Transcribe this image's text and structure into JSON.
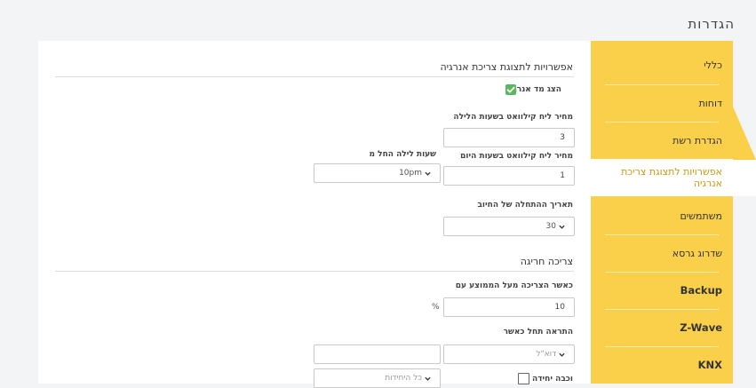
{
  "page": {
    "title": "הגדרות"
  },
  "sidebar": {
    "items": [
      {
        "label": "כללי"
      },
      {
        "label": "דוחות"
      },
      {
        "label": "הגדרת רשת"
      },
      {
        "label": "אפשרויות לתצוגת צריכת אנרגיה",
        "active": true
      },
      {
        "label": "משתמשים"
      },
      {
        "label": "שדרוג גרסא"
      },
      {
        "label": "Backup"
      },
      {
        "label": "Z-Wave"
      },
      {
        "label": "KNX"
      }
    ]
  },
  "energy": {
    "section_title": "אפשרויות לתצוגת צריכת אנרגיה",
    "show_meter_label": "הצג מד אנרגיה",
    "show_meter_checked": true,
    "night_price_label": "מחיר ליח קילוואט בשעות הלילה",
    "night_price_value": "3",
    "day_price_label": "מחיר ליח קילוואט בשעות היום",
    "day_price_value": "1",
    "night_start_label": "שעות לילה החל מ",
    "night_start_value": "10pm",
    "billing_start_label": "תאריך ההתחלה של החיוב",
    "billing_start_value": "30"
  },
  "anomaly": {
    "section_title": "צריכה חריגה",
    "threshold_label": "כאשר הצריכה מעל הממוצע עם",
    "threshold_value": "10",
    "threshold_unit": "%",
    "alert_label": "התראה תחל כאשר",
    "alert_select_placeholder": "דוא\"ל",
    "unit_off_label": "וכבה יחידה",
    "all_units_placeholder": "כל היחידות"
  },
  "colors": {
    "accent": "#fad04a",
    "active_text": "#c89a10",
    "checkbox": "#5cb85c"
  }
}
